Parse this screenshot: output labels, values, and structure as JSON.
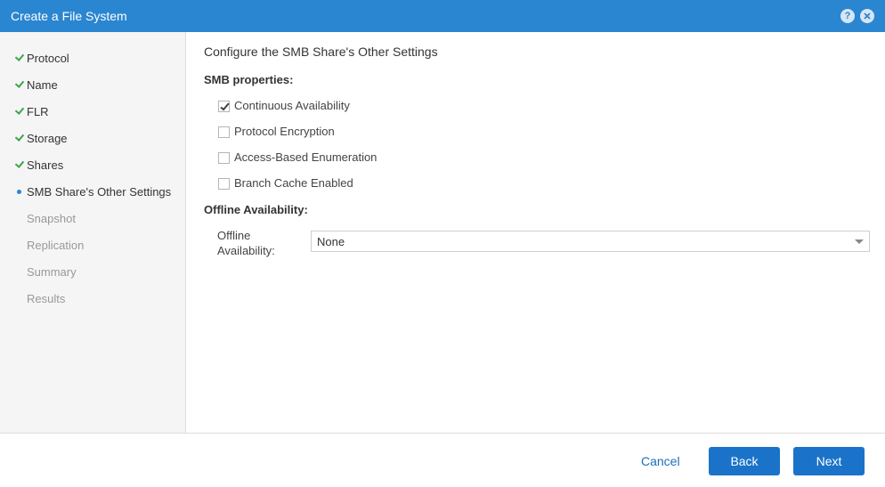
{
  "window": {
    "title": "Create a File System",
    "help_icon": "?",
    "accent_color": "#2a86d1"
  },
  "sidebar": {
    "steps": [
      {
        "label": "Protocol",
        "state": "done"
      },
      {
        "label": "Name",
        "state": "done"
      },
      {
        "label": "FLR",
        "state": "done"
      },
      {
        "label": "Storage",
        "state": "done"
      },
      {
        "label": "Shares",
        "state": "done"
      },
      {
        "label": "SMB Share's Other Settings",
        "state": "current"
      },
      {
        "label": "Snapshot",
        "state": "pending"
      },
      {
        "label": "Replication",
        "state": "pending"
      },
      {
        "label": "Summary",
        "state": "pending"
      },
      {
        "label": "Results",
        "state": "pending"
      }
    ]
  },
  "main": {
    "title": "Configure the SMB Share's Other Settings",
    "smb_section_label": "SMB properties:",
    "checkboxes": [
      {
        "label": "Continuous Availability",
        "checked": true
      },
      {
        "label": "Protocol Encryption",
        "checked": false
      },
      {
        "label": "Access-Based Enumeration",
        "checked": false
      },
      {
        "label": "Branch Cache Enabled",
        "checked": false
      }
    ],
    "offline_section_label": "Offline Availability:",
    "offline_field_label": "Offline Availability:",
    "offline_value": "None"
  },
  "footer": {
    "cancel_label": "Cancel",
    "back_label": "Back",
    "next_label": "Next"
  }
}
